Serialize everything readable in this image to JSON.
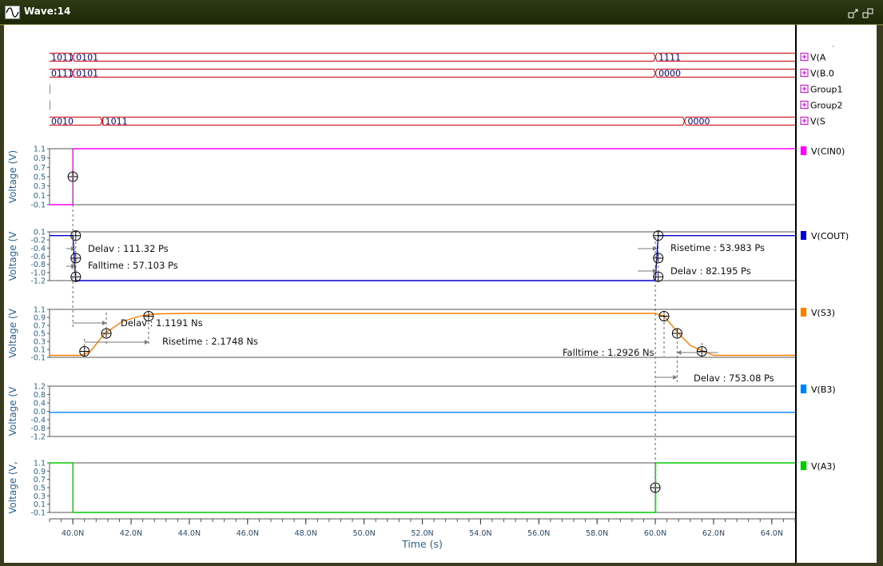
{
  "window": {
    "title": "Wave:14"
  },
  "bus_signals": [
    {
      "label": "V(A",
      "segments": [
        "1011",
        "0101",
        "1111"
      ]
    },
    {
      "label": "V(B.0",
      "segments": [
        "0111",
        "0101",
        "0000"
      ]
    },
    {
      "label": "Group1",
      "segments": []
    },
    {
      "label": "Group2",
      "segments": []
    },
    {
      "label": "V(S",
      "segments": [
        "0010",
        "1011",
        "0000"
      ]
    }
  ],
  "chart_data": {
    "type": "line",
    "x_unit": "s",
    "xlabel": "Time (s)",
    "xlim": [
      39.2,
      64.8
    ],
    "x_ticks": [
      40,
      42,
      44,
      46,
      48,
      50,
      52,
      54,
      56,
      58,
      60,
      62,
      64
    ],
    "x_tick_labels": [
      "40.0N",
      "42.0N",
      "44.0N",
      "46.0N",
      "48.0N",
      "50.0N",
      "52.0N",
      "54.0N",
      "56.0N",
      "58.0N",
      "60.0N",
      "62.0N",
      "64.0N"
    ],
    "panels": [
      {
        "name": "V(CIN0)",
        "color": "#ff00ff",
        "ylabel": "Voltage (V)",
        "ylim": [
          -0.1,
          1.1
        ],
        "yticks": [
          "1.1",
          "0.9",
          "0.7",
          "0.5",
          "0.3",
          "0.1",
          "-0.1"
        ],
        "x": [
          39.2,
          40.0,
          40.0,
          64.8
        ],
        "y": [
          -0.1,
          -0.1,
          1.1,
          1.1
        ],
        "markers": [
          {
            "x": 40.0,
            "y": 0.5
          }
        ],
        "annotations": []
      },
      {
        "name": "V(COUT)",
        "color": "#0000cc",
        "ylabel": "Voltage (V",
        "ylim": [
          -1.2,
          0.1
        ],
        "yticks": [
          "0.1",
          "-0.2",
          "-0.4",
          "-0.6",
          "-0.8",
          "-1.0",
          "-1.2"
        ],
        "x": [
          39.2,
          40.0,
          40.1,
          60.0,
          60.1,
          64.8
        ],
        "y": [
          0.0,
          0.0,
          -1.2,
          -1.2,
          0.0,
          0.0
        ],
        "markers": [
          {
            "x": 40.1,
            "y": 0.0
          },
          {
            "x": 40.1,
            "y": -0.6
          },
          {
            "x": 40.1,
            "y": -1.1
          },
          {
            "x": 60.1,
            "y": 0.0
          },
          {
            "x": 60.1,
            "y": -0.6
          },
          {
            "x": 60.1,
            "y": -1.1
          }
        ],
        "annotations": [
          "Delav : 111.32 Ps",
          "Falltime : 57.103 Ps",
          "Risetime : 53.983 Ps",
          "Delav : 82.195 Ps"
        ]
      },
      {
        "name": "V(S3)",
        "color": "#ff8000",
        "ylabel": "Voltage (V",
        "ylim": [
          -0.1,
          1.1
        ],
        "yticks": [
          "1.1",
          "0.9",
          "0.7",
          "0.5",
          "0.3",
          "0.1",
          "-0.1"
        ],
        "x": [
          39.2,
          40.3,
          40.6,
          41.1,
          41.7,
          42.3,
          42.6,
          43.0,
          44.0,
          60.0,
          60.3,
          60.8,
          61.2,
          61.6,
          62.0,
          64.8
        ],
        "y": [
          -0.05,
          -0.05,
          0.05,
          0.5,
          0.8,
          0.93,
          0.97,
          0.99,
          1.0,
          1.0,
          0.93,
          0.5,
          0.2,
          0.07,
          -0.05,
          -0.05
        ],
        "markers": [
          {
            "x": 40.4,
            "y": 0.05
          },
          {
            "x": 41.15,
            "y": 0.5
          },
          {
            "x": 42.6,
            "y": 0.93
          },
          {
            "x": 60.3,
            "y": 0.93
          },
          {
            "x": 60.75,
            "y": 0.5
          },
          {
            "x": 61.6,
            "y": 0.05
          }
        ],
        "annotations": [
          "Delav : 1.1191 Ns",
          "Risetime : 2.1748 Ns",
          "Falltime : 1.2926 Ns",
          "Delav : 753.08 Ps"
        ]
      },
      {
        "name": "V(B3)",
        "color": "#0080ff",
        "ylabel": "Voltage (V",
        "ylim": [
          -1.2,
          1.2
        ],
        "yticks": [
          "1.2",
          "0.8",
          "0.4",
          "0.0",
          "-0.4",
          "-0.8",
          "-1.2"
        ],
        "x": [
          39.2,
          64.8
        ],
        "y": [
          -0.05,
          -0.05
        ],
        "markers": [],
        "annotations": []
      },
      {
        "name": "V(A3)",
        "color": "#00cc00",
        "ylabel": "Voltage (V,",
        "ylim": [
          -0.1,
          1.1
        ],
        "yticks": [
          "1.1",
          "0.9",
          "0.7",
          "0.5",
          "0.3",
          "0.1",
          "-0.1"
        ],
        "x": [
          39.2,
          40.0,
          40.0,
          60.0,
          60.0,
          64.8
        ],
        "y": [
          1.1,
          1.1,
          -0.1,
          -0.1,
          1.1,
          1.1
        ],
        "markers": [
          {
            "x": 60.0,
            "y": 0.5
          }
        ],
        "annotations": []
      }
    ]
  },
  "colors": {
    "titlebar": "#24300c",
    "bus": "#cc0000",
    "bus_text": "#00008b",
    "axis_text": "#2a6496",
    "grid_dashed": "#666666",
    "legend_plus": "#cc00cc"
  },
  "icons": [
    "waveform-icon",
    "restore-icon",
    "maximize-icon",
    "plus-box-icon",
    "circle-cross-marker-icon"
  ]
}
